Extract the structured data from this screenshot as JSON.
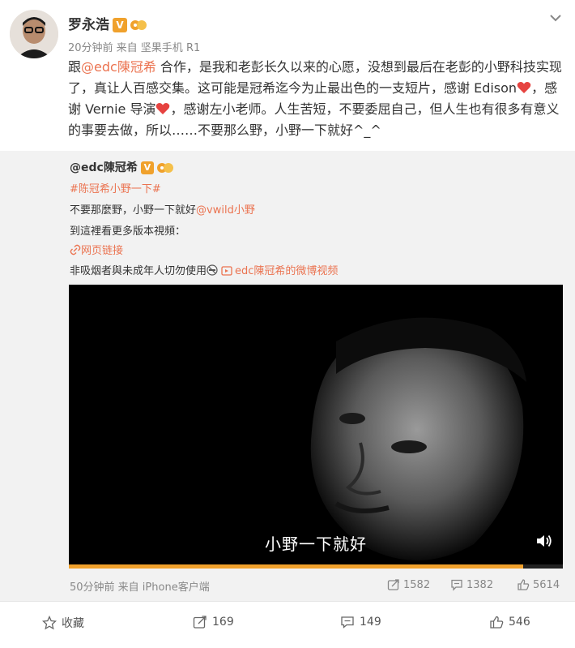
{
  "post": {
    "author": "罗永浩",
    "meta": "20分钟前 来自 坚果手机 R1",
    "text_parts": {
      "p1": "跟",
      "mention": "@edc陳冠希",
      "p2": " 合作，是我和老彭长久以来的心愿，没想到最后在老彭的小野科技实现了，真让人百感交集。这可能是冠希迄今为止最出色的一支短片，感谢 Edison",
      "p3": "，感谢 Vernie 导演",
      "p4": "，感谢左小老师。人生苦短，不要委屈自己，但人生也有很多有意义的事要去做，所以……不要那么野，小野一下就好^_^"
    }
  },
  "repost": {
    "author": "@edc陳冠希",
    "hashtag": "#陈冠希小野一下#",
    "line1_text": "不要那麼野，小野一下就好",
    "line1_mention": "@vwild小野",
    "line2": "到這裡看更多版本視頻：",
    "weblink": "网页链接",
    "line4_text": "非吸烟者與未成年人切勿使用",
    "video_link": "edc陳冠希的微博视频",
    "video": {
      "subtitle": "小野一下就好",
      "progress": 0.92
    },
    "footer": {
      "time": "50分钟前 来自 iPhone客户端",
      "reposts": "1582",
      "comments": "1382",
      "likes": "5614"
    }
  },
  "bottombar": {
    "favorite": "收藏",
    "reposts": "169",
    "comments": "149",
    "likes": "546"
  },
  "icons": [
    "chevron-down-icon",
    "verified-icon",
    "level-icon",
    "heart-icon",
    "link-icon",
    "no-smoking-icon",
    "video-icon",
    "volume-icon",
    "repost-icon",
    "comment-icon",
    "like-icon",
    "star-icon"
  ],
  "colors": {
    "link": "#eb7350",
    "badge": "#f0a12c"
  }
}
